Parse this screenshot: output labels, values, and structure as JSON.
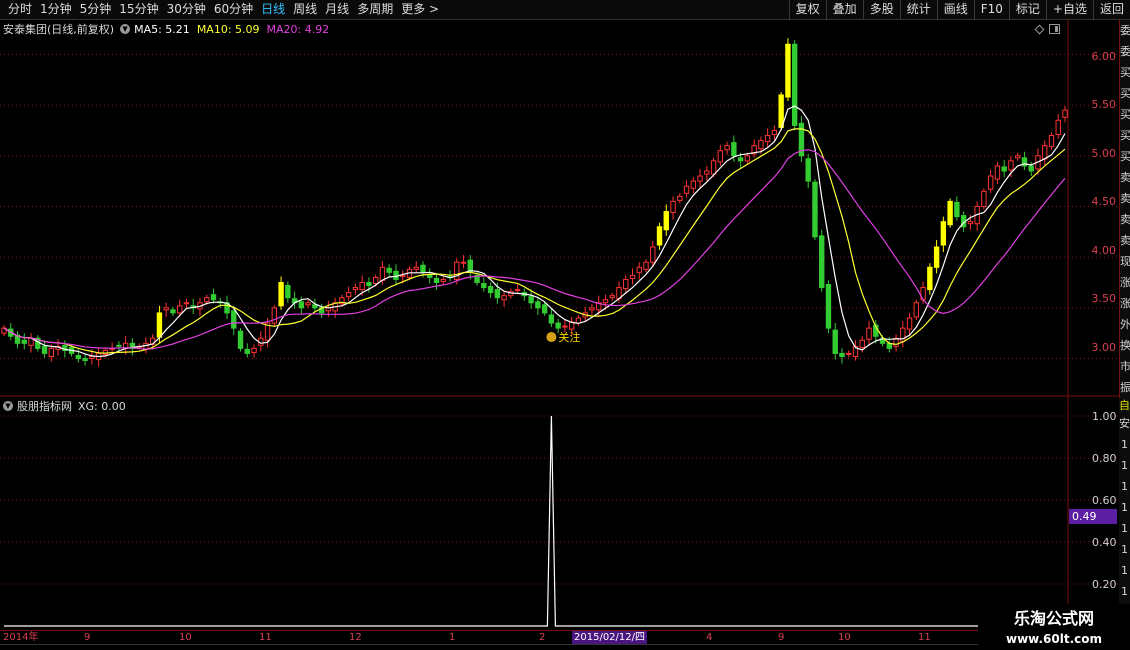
{
  "toolbar": {
    "period_tabs": [
      "分时",
      "1分钟",
      "5分钟",
      "15分钟",
      "30分钟",
      "60分钟",
      "日线",
      "周线",
      "月线",
      "多周期",
      "更多 >"
    ],
    "active_tab": "日线",
    "buttons": [
      "复权",
      "叠加",
      "多股",
      "统计",
      "画线",
      "F10",
      "标记",
      "+自选",
      "返回"
    ]
  },
  "main_panel": {
    "stock_title": "安泰集团(日线,前复权)",
    "ma5": {
      "label": "MA5: 5.21",
      "color": "#ffffff"
    },
    "ma10": {
      "label": "MA10: 5.09",
      "color": "#ffff33"
    },
    "ma20": {
      "label": "MA20: 4.92",
      "color": "#e040e0"
    },
    "price_axis": [
      "6.00",
      "5.50",
      "5.00",
      "4.50",
      "4.00",
      "3.50",
      "3.00"
    ],
    "marker_label": "关注",
    "marker_icon": "money-bag-icon"
  },
  "sub_panel": {
    "indicator_name": "股朋指标网",
    "indicator_value": "XG: 0.00",
    "axis": [
      "1.00",
      "0.80",
      "0.60",
      "0.40",
      "0.20"
    ],
    "current_value_tag": "0.49"
  },
  "right_strip": {
    "upper_chars": [
      "委",
      "委",
      "买",
      "买",
      "买",
      "买",
      "买",
      "卖",
      "卖",
      "卖",
      "卖",
      "现",
      "涨",
      "涨",
      "外",
      "换",
      "市",
      "振"
    ],
    "lower_chars": [
      "自",
      "安",
      "1",
      "1",
      "1",
      "1",
      "1",
      "1",
      "1",
      "1",
      "1",
      "1"
    ]
  },
  "date_axis": {
    "labels": [
      "2014年",
      "9",
      "10",
      "11",
      "12",
      "1",
      "2",
      "2015/02/12/四",
      "4",
      "9",
      "10",
      "11"
    ],
    "highlight": "2015/02/12/四"
  },
  "watermark": {
    "title": "乐淘公式网",
    "url": "www.60lt.com"
  },
  "colors": {
    "up": "#ff3333",
    "down": "#33cc33",
    "signal": "#ffff00",
    "ma5": "#ffffff",
    "ma10": "#ffff33",
    "ma20": "#e040e0",
    "grid": "#7a1010",
    "axis_text": "#d74050",
    "highlight": "#5c1fa3"
  },
  "chart_data": {
    "type": "candlestick",
    "ylim": [
      2.65,
      6.3
    ],
    "signal_day_index": 81,
    "closes": [
      3.3,
      3.22,
      3.15,
      3.15,
      3.2,
      3.1,
      3.05,
      3.1,
      3.12,
      3.08,
      3.05,
      3.0,
      2.98,
      3.02,
      3.05,
      3.08,
      3.1,
      3.12,
      3.15,
      3.1,
      3.12,
      3.15,
      3.2,
      3.45,
      3.5,
      3.45,
      3.52,
      3.55,
      3.5,
      3.55,
      3.6,
      3.58,
      3.55,
      3.45,
      3.3,
      3.1,
      3.05,
      3.1,
      3.2,
      3.35,
      3.5,
      3.75,
      3.6,
      3.55,
      3.5,
      3.55,
      3.5,
      3.45,
      3.5,
      3.55,
      3.6,
      3.65,
      3.7,
      3.75,
      3.72,
      3.8,
      3.9,
      3.85,
      3.78,
      3.82,
      3.88,
      3.9,
      3.85,
      3.8,
      3.75,
      3.78,
      3.8,
      3.95,
      3.95,
      3.85,
      3.75,
      3.7,
      3.65,
      3.6,
      3.62,
      3.66,
      3.68,
      3.62,
      3.55,
      3.5,
      3.45,
      3.35,
      3.3,
      3.32,
      3.36,
      3.4,
      3.45,
      3.5,
      3.55,
      3.58,
      3.62,
      3.7,
      3.78,
      3.82,
      3.9,
      3.95,
      4.1,
      4.3,
      4.45,
      4.55,
      4.6,
      4.7,
      4.75,
      4.8,
      4.85,
      4.95,
      5.05,
      5.1,
      5.0,
      4.95,
      5.0,
      5.1,
      5.15,
      5.2,
      5.25,
      5.6,
      6.1,
      5.3,
      5.0,
      4.75,
      4.2,
      3.7,
      3.3,
      3.05,
      3.02,
      3.05,
      3.12,
      3.18,
      3.3,
      3.22,
      3.15,
      3.1,
      3.2,
      3.3,
      3.4,
      3.55,
      3.7,
      3.9,
      4.1,
      4.35,
      4.55,
      4.4,
      4.3,
      4.35,
      4.5,
      4.65,
      4.8,
      4.9,
      4.85,
      4.95,
      5.0,
      4.9,
      4.85,
      5.0,
      5.1,
      5.2,
      5.35,
      5.45
    ]
  }
}
